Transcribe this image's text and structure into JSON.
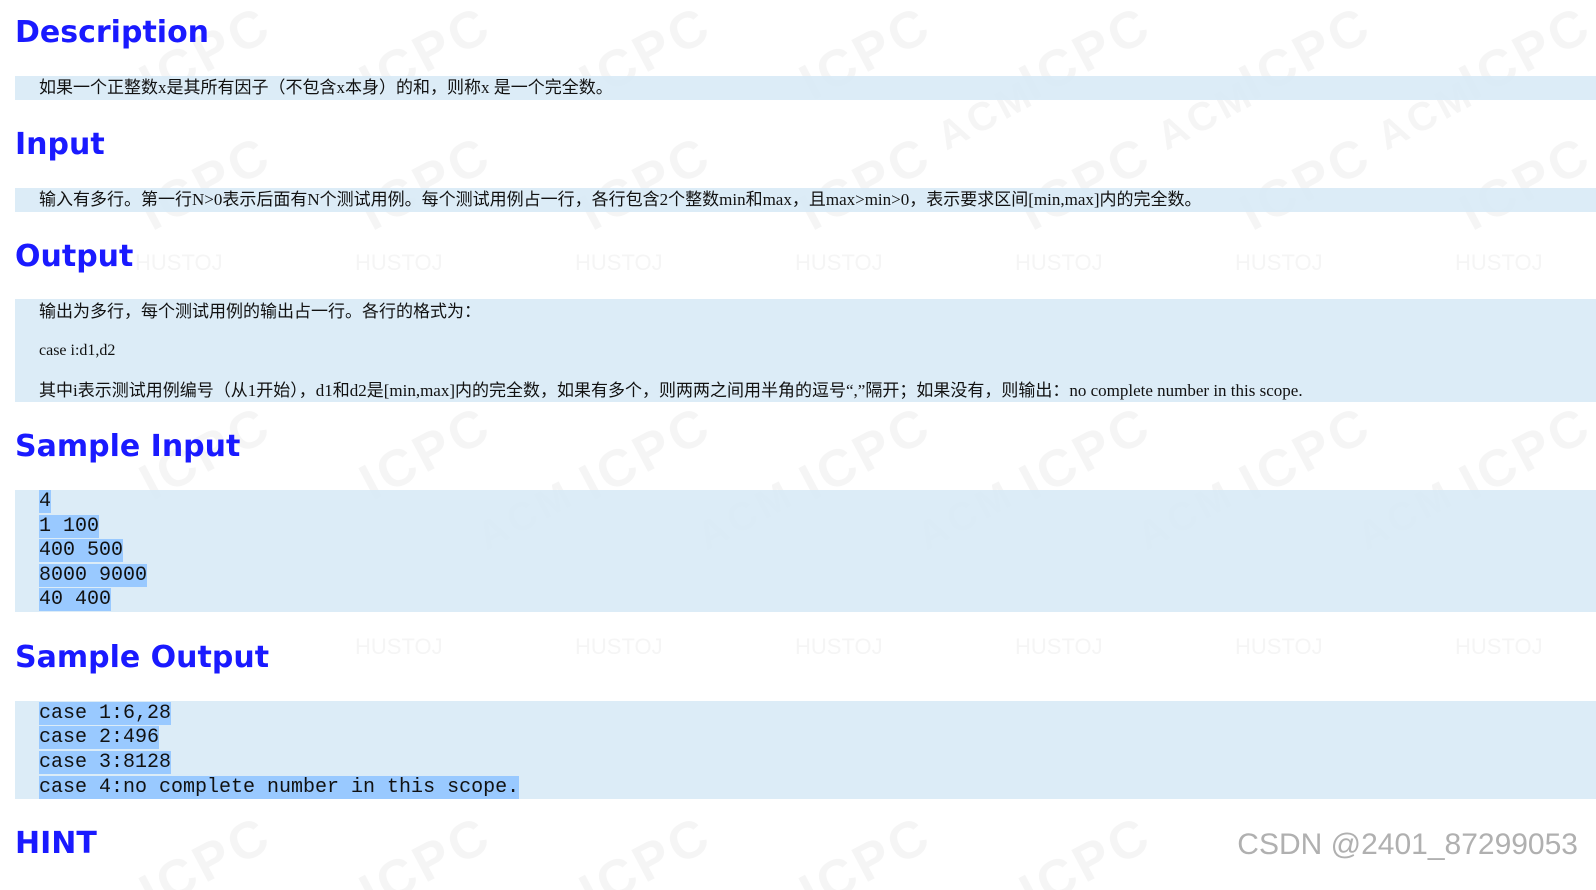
{
  "sections": {
    "description": {
      "title": "Description",
      "text": "如果一个正整数x是其所有因子（不包含x本身）的和，则称x 是一个完全数。"
    },
    "input": {
      "title": "Input",
      "text": "输入有多行。第一行N>0表示后面有N个测试用例。每个测试用例占一行，各行包含2个整数min和max，且max>min>0，表示要求区间[min,max]内的完全数。"
    },
    "output": {
      "title": "Output",
      "line1": "输出为多行，每个测试用例的输出占一行。各行的格式为：",
      "line2": "case i:d1,d2",
      "line3": "其中i表示测试用例编号（从1开始），d1和d2是[min,max]内的完全数，如果有多个，则两两之间用半角的逗号“,”隔开；如果没有，则输出：no complete number in this scope."
    },
    "sample_input": {
      "title": "Sample Input",
      "lines": [
        "4",
        "1 100",
        "400 500",
        "8000 9000",
        "40 400"
      ]
    },
    "sample_output": {
      "title": "Sample Output",
      "lines": [
        "case 1:6,28",
        "case 2:496",
        "case 3:8128",
        "case 4:no complete number in this scope."
      ]
    },
    "hint": {
      "title": "HINT"
    }
  },
  "watermark": {
    "site": "ICPC",
    "brand": "HUSTOJ",
    "acm": "ACM",
    "csdn": "CSDN @2401_87299053"
  },
  "colors": {
    "heading": "#1a1aff",
    "block_bg": "#d6e9f6",
    "selection": "#99c9ff"
  }
}
